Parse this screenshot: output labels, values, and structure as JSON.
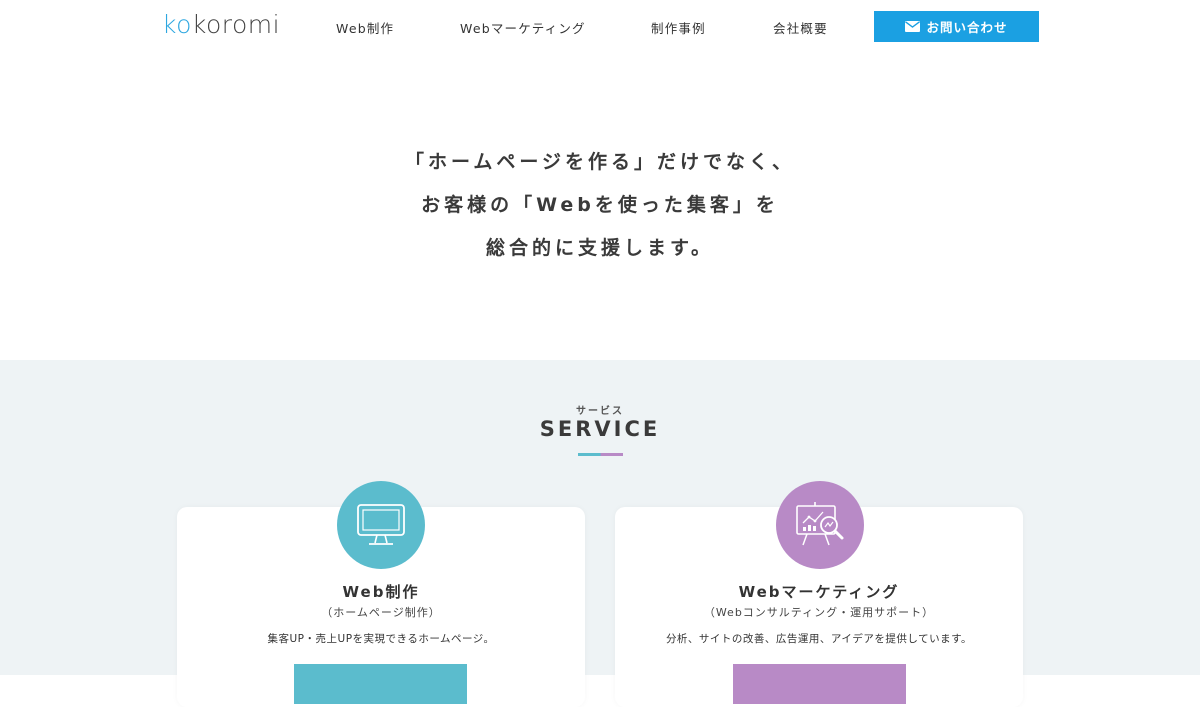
{
  "header": {
    "logo_prefix": "ko",
    "logo_rest": "koromi",
    "nav": [
      {
        "label": "Web制作"
      },
      {
        "label": "Webマーケティング"
      },
      {
        "label": "制作事例"
      },
      {
        "label": "会社概要"
      }
    ],
    "contact_label": "お問い合わせ",
    "contact_icon": "mail-icon"
  },
  "hero": {
    "lines": [
      "「ホームページを作る」だけでなく、",
      "お客様の「Webを使った集客」を",
      "総合的に支援します。"
    ]
  },
  "service": {
    "kana": "サービス",
    "title": "SERVICE",
    "cards": [
      {
        "title": "Web制作",
        "subtitle": "（ホームページ制作）",
        "description": "集客UP・売上UPを実現できるホームページ。",
        "icon": "monitor-icon",
        "color": "#5bbccd"
      },
      {
        "title": "Webマーケティング",
        "subtitle": "（Webコンサルティング・運用サポート）",
        "description": "分析、サイトの改善、広告運用、アイデアを提供しています。",
        "icon": "analytics-board-icon",
        "color": "#b88ac6"
      }
    ]
  },
  "colors": {
    "accent_blue": "#1ba0e2",
    "logo_blue": "#2ea7e0",
    "teal": "#5bbccd",
    "purple": "#b88ac6",
    "section_bg": "#eef3f5"
  }
}
